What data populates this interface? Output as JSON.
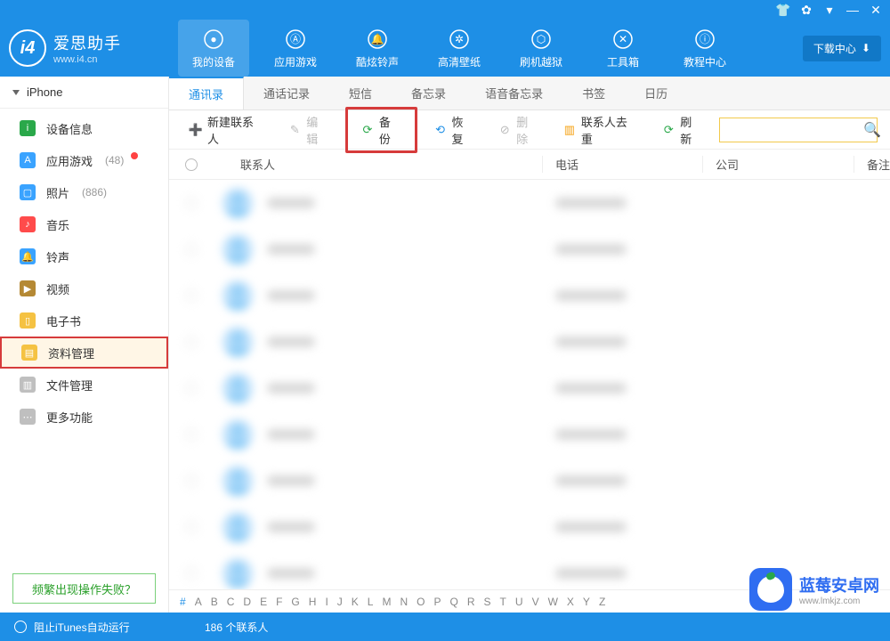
{
  "app": {
    "title_cn": "爱思助手",
    "title_en": "www.i4.cn"
  },
  "window_controls": [
    "shirt",
    "gear",
    "menu",
    "min",
    "close"
  ],
  "download_center": "下载中心",
  "nav": [
    {
      "id": "device",
      "label": "我的设备",
      "active": true
    },
    {
      "id": "apps",
      "label": "应用游戏"
    },
    {
      "id": "rings",
      "label": "酷炫铃声"
    },
    {
      "id": "wallpaper",
      "label": "高清壁纸"
    },
    {
      "id": "flash",
      "label": "刷机越狱"
    },
    {
      "id": "tools",
      "label": "工具箱"
    },
    {
      "id": "tutorial",
      "label": "教程中心"
    }
  ],
  "device_name": "iPhone",
  "sidebar": [
    {
      "id": "info",
      "label": "设备信息",
      "color": "#2aa84a",
      "glyph": "i"
    },
    {
      "id": "appgames",
      "label": "应用游戏",
      "color": "#3aa3ff",
      "glyph": "A",
      "count": "(48)",
      "dot": true
    },
    {
      "id": "photos",
      "label": "照片",
      "color": "#3aa3ff",
      "glyph": "▢",
      "count": "(886)"
    },
    {
      "id": "music",
      "label": "音乐",
      "color": "#ff4b4b",
      "glyph": "♪"
    },
    {
      "id": "ringtone",
      "label": "铃声",
      "color": "#3aa3ff",
      "glyph": "🔔"
    },
    {
      "id": "video",
      "label": "视频",
      "color": "#b58934",
      "glyph": "▶"
    },
    {
      "id": "ebook",
      "label": "电子书",
      "color": "#f5c242",
      "glyph": "▯"
    },
    {
      "id": "datamgmt",
      "label": "资料管理",
      "color": "#f5c242",
      "glyph": "▤",
      "selected": true
    },
    {
      "id": "filemgmt",
      "label": "文件管理",
      "color": "#bfbfbf",
      "glyph": "▥"
    },
    {
      "id": "more",
      "label": "更多功能",
      "color": "#bfbfbf",
      "glyph": "⋯"
    }
  ],
  "sidebar_help": "频繁出现操作失败？",
  "tabs": [
    {
      "label": "通讯录",
      "active": true
    },
    {
      "label": "通话记录"
    },
    {
      "label": "短信"
    },
    {
      "label": "备忘录"
    },
    {
      "label": "语音备忘录"
    },
    {
      "label": "书签"
    },
    {
      "label": "日历"
    }
  ],
  "toolbar": {
    "new_contact": "新建联系人",
    "edit": "编辑",
    "backup": "备份",
    "restore": "恢复",
    "delete": "删除",
    "dedupe": "联系人去重",
    "refresh": "刷新",
    "search_placeholder": ""
  },
  "columns": {
    "name": "联系人",
    "phone": "电话",
    "company": "公司",
    "note": "备注"
  },
  "alpha_index": [
    "#",
    "A",
    "B",
    "C",
    "D",
    "E",
    "F",
    "G",
    "H",
    "I",
    "J",
    "K",
    "L",
    "M",
    "N",
    "O",
    "P",
    "Q",
    "R",
    "S",
    "T",
    "U",
    "V",
    "W",
    "X",
    "Y",
    "Z"
  ],
  "footer": {
    "itunes_block": "阻止iTunes自动运行",
    "contact_count": "186 个联系人"
  },
  "row_count": 9,
  "watermark": {
    "line1": "蓝莓安卓网",
    "line2": "www.lmkjz.com"
  }
}
